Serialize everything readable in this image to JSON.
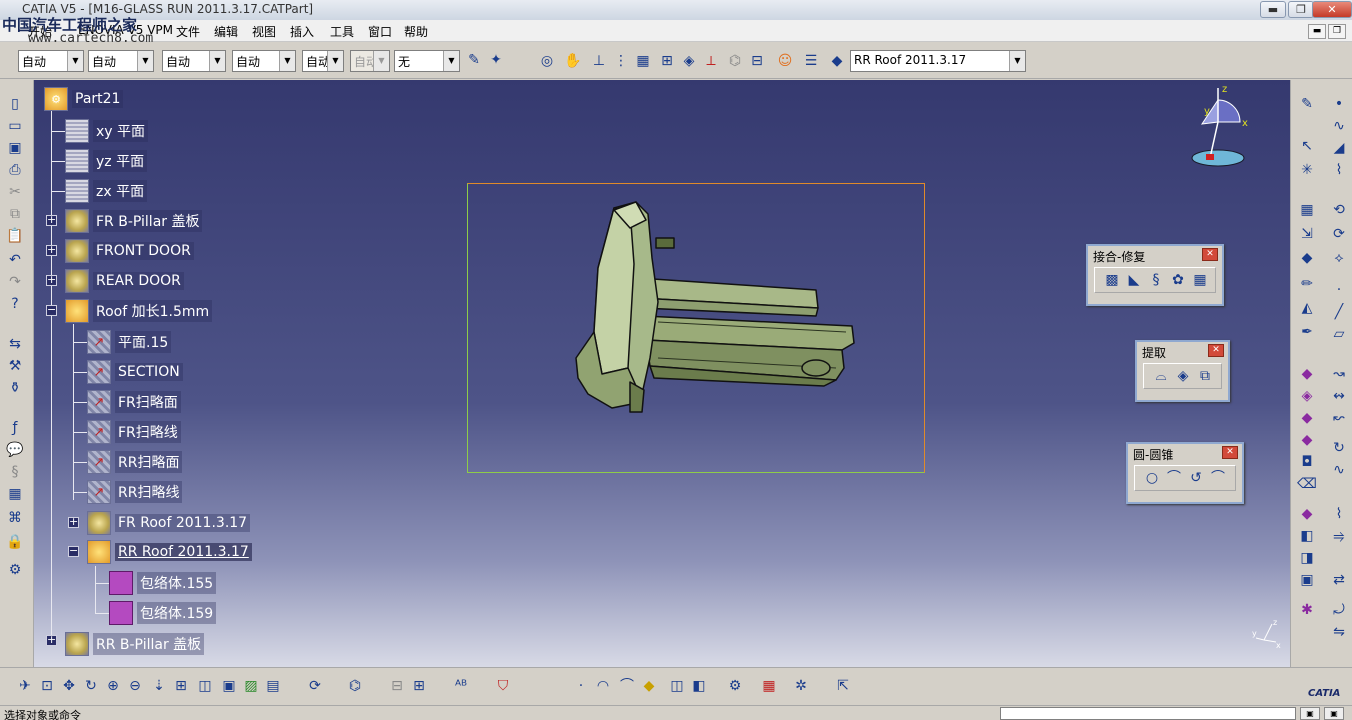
{
  "window": {
    "title": "CATIA V5 - [M16-GLASS RUN 2011.3.17.CATPart]",
    "min_label": "▬",
    "max_label": "❐",
    "close_label": "✕",
    "doc_min": "▬",
    "doc_max": "❐",
    "doc_close": "✕"
  },
  "watermark": {
    "text": "中国汽车工程师之家",
    "url": "www.cartech8.com"
  },
  "menu": [
    "开始",
    "ENOVIA V5 VPM",
    "文件",
    "编辑",
    "视图",
    "插入",
    "工具",
    "窗口",
    "帮助"
  ],
  "toolbar": {
    "combos": [
      "自动",
      "自动",
      "自动",
      "自动",
      "自动",
      "自动",
      "无"
    ],
    "layer_combo": "RR Roof 2011.3.17"
  },
  "tree": {
    "root": "Part21",
    "nodes": [
      {
        "label": "xy 平面",
        "kind": "plane"
      },
      {
        "label": "yz 平面",
        "kind": "plane"
      },
      {
        "label": "zx 平面",
        "kind": "plane"
      },
      {
        "label": "FR B-Pillar 盖板",
        "kind": "body",
        "expander": "+"
      },
      {
        "label": "FRONT DOOR",
        "kind": "body",
        "expander": "+"
      },
      {
        "label": "REAR DOOR",
        "kind": "body",
        "expander": "+"
      },
      {
        "label": "Roof 加长1.5mm",
        "kind": "geo",
        "expander": "−"
      },
      {
        "label": "平面.15",
        "kind": "sketch"
      },
      {
        "label": "SECTION",
        "kind": "sketch"
      },
      {
        "label": "FR扫略面",
        "kind": "sketch"
      },
      {
        "label": "FR扫略线",
        "kind": "sketch"
      },
      {
        "label": "RR扫略面",
        "kind": "sketch"
      },
      {
        "label": "RR扫略线",
        "kind": "sketch"
      },
      {
        "label": "FR Roof 2011.3.17",
        "kind": "body",
        "expander": "+"
      },
      {
        "label": "RR Roof 2011.3.17",
        "kind": "geo",
        "expander": "−"
      },
      {
        "label": "包络体.155",
        "kind": "cube"
      },
      {
        "label": "包络体.159",
        "kind": "cube"
      },
      {
        "label": "RR B-Pillar 盖板",
        "kind": "body",
        "expander": "+"
      }
    ]
  },
  "panels": {
    "join": {
      "title": "接合-修复",
      "close": "✕"
    },
    "extract": {
      "title": "提取",
      "close": "✕"
    },
    "circle": {
      "title": "圆-圆锥",
      "close": "✕"
    }
  },
  "compass": {
    "x": "x",
    "y": "y",
    "z": "z"
  },
  "status": {
    "text": "选择对象或命令"
  },
  "brand": "CATIA"
}
